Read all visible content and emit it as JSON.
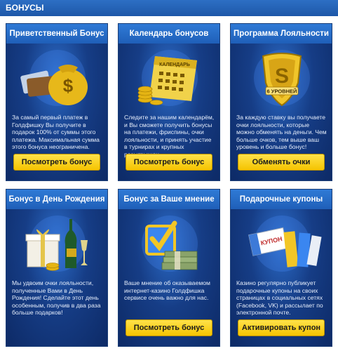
{
  "header": {
    "title": "БОНУСЫ"
  },
  "cards": [
    {
      "title": "Приветственный Бонус",
      "desc": "За самый первый платеж в Голдфишку Вы получите в подарок 100% от суммы этого платежа. Максимальная сумма этого бонуса неограничена.",
      "button": "Посмотреть бонус",
      "image_icon": "money-bag-and-cards-icon"
    },
    {
      "title": "Календарь бонусов",
      "desc": "Следите за нашим календарём, и Вы сможете получить бонусы на платежи, фриспины, очки лояльности, и принять участие в турнирах и крупных розыгрышах.",
      "button": "Посмотреть бонус",
      "image_icon": "calendar-and-coins-icon",
      "image_text": "КАЛЕНДАРЬ"
    },
    {
      "title": "Программа Лояльности",
      "desc": "За каждую ставку вы получаете очки лояльности, которые можно обменять на деньги. Чем больше очков, тем выше ваш уровень и больше бонус!",
      "button": "Обменять очки",
      "image_icon": "gold-shield-icon",
      "image_text": "6 УРОВНЕЙ"
    },
    {
      "title": "Бонус в День Рождения",
      "desc": "Мы удвоим очки лояльности, полученные Вами в День Рождения! Сделайте этот день особенным, получив в два раза больше подарков!",
      "button": "",
      "image_icon": "gift-and-champagne-icon"
    },
    {
      "title": "Бонус за Ваше мнение",
      "desc": "Ваше мнение об оказываемом интернет-казино Голдфишка сервисе очень важно для нас.",
      "button": "Посмотреть бонус",
      "image_icon": "checkbox-and-cash-icon"
    },
    {
      "title": "Подарочные купоны",
      "desc": "Казино регулярно публикует подарочные купоны на своих страницах в социальных сетях (Facebook, VK) и рассылает по электронной почте.",
      "button": "Активировать купон",
      "image_icon": "coupons-icon",
      "image_text": "КУПОН"
    }
  ],
  "colors": {
    "header_blue": "#1f5fb8",
    "button_yellow": "#f5c400",
    "card_dark_blue": "#0d2a66"
  }
}
